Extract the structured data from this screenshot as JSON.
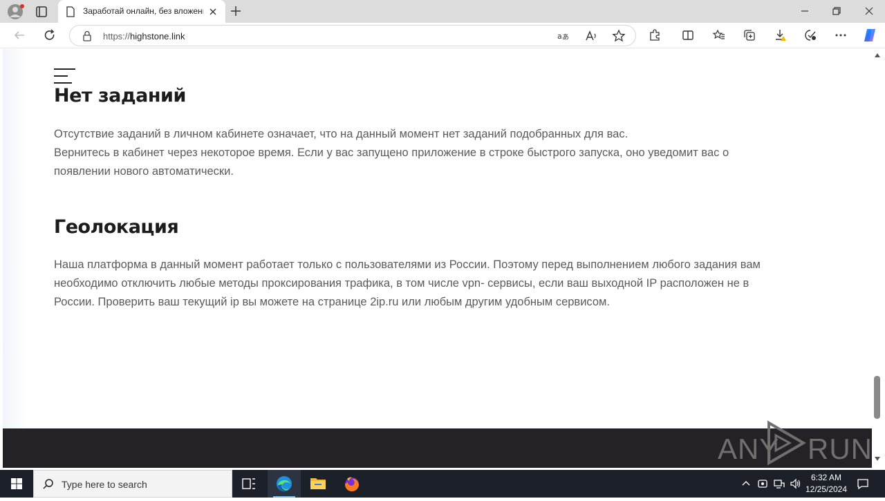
{
  "browser": {
    "tab": {
      "title": "Заработай онлайн, без вложени"
    },
    "address": {
      "scheme": "https://",
      "host": "highstone.link"
    }
  },
  "page": {
    "sections": [
      {
        "heading": "Нет заданий",
        "lines": [
          "Отсутствие заданий в личном кабинете означает, что на данный момент нет заданий подобранных для вас.",
          "Вернитесь в кабинет через некоторое время. Если у вас запущено приложение в строке быстрого запуска, оно уведомит вас о",
          "появлении нового автоматически."
        ]
      },
      {
        "heading": "Геолокация",
        "lines": [
          "Наша платформа в данный момент работает только с пользователями из России. Поэтому перед выполнением любого задания вам",
          "необходимо отключить любые методы проксирования трафика, в том числе vpn- сервисы, если ваш выходной IP расположен не в",
          "России. Проверить ваш текущий ip вы можете на странице 2ip.ru или любым другим удобным сервисом."
        ]
      }
    ],
    "watermark": {
      "left": "ANY",
      "right": "RUN"
    }
  },
  "taskbar": {
    "search_placeholder": "Type here to search",
    "time": "6:32 AM",
    "date": "12/25/2024"
  },
  "colors": {
    "accent": "#0078d4",
    "footer": "#242227",
    "taskbar": "#1b2029"
  }
}
